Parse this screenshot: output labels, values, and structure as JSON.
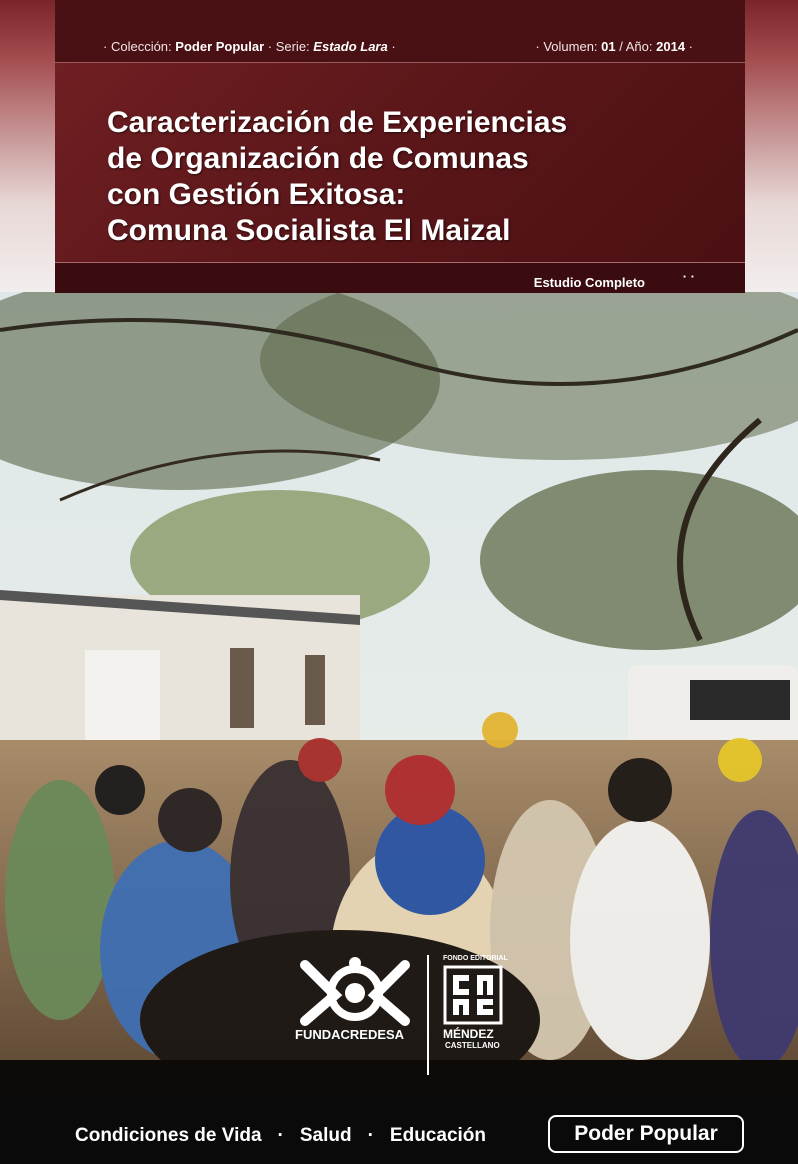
{
  "header": {
    "collection_label": "Colección:",
    "collection_value": "Poder Popular",
    "series_label": "Serie:",
    "series_value": "Estado Lara",
    "volume_label": "Volumen:",
    "volume_value": "01",
    "year_label": "Año:",
    "year_value": "2014"
  },
  "title": {
    "line1": "Caracterización de Experiencias",
    "line2": "de Organización de Comunas",
    "line3": "con Gestión Exitosa:",
    "line4": "Comuna Socialista El Maizal"
  },
  "study_label": "Estudio Completo",
  "logos": {
    "fundacredesa": "FUNDACREDESA",
    "fondo_label": "FONDO EDITORIAL",
    "mendez": "MÉNDEZ",
    "castellano": "CASTELLANO"
  },
  "footer": {
    "item1": "Condiciones de Vida",
    "item2": "Salud",
    "item3": "Educación",
    "button": "Poder Popular"
  },
  "colors": {
    "maroon": "#5a1619",
    "dark_maroon": "#3a0c0f",
    "footer_bg": "#0a0a0a"
  }
}
